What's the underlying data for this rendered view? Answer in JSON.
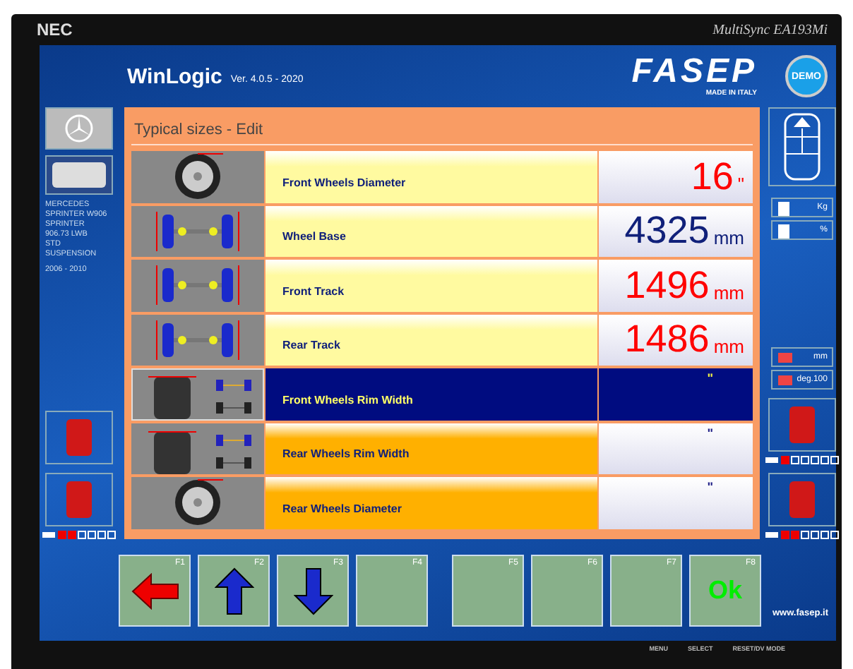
{
  "monitor": {
    "brand": "NEC",
    "model": "MultiSync EA193Mi",
    "buttons": [
      "MENU",
      "SELECT",
      "RESET/DV MODE"
    ]
  },
  "header": {
    "app": "WinLogic",
    "version": "Ver. 4.0.5 - 2020",
    "logo": "FASEP",
    "logo_tag": "MADE IN ITALY",
    "demo": "DEMO"
  },
  "vehicle": {
    "lines": [
      "MERCEDES",
      "SPRINTER W906",
      "SPRINTER",
      "906.73 LWB",
      "STD",
      "SUSPENSION"
    ],
    "years": "2006 - 2010"
  },
  "left_indicator": [
    {
      "on": true
    },
    {
      "on": true
    },
    {
      "on": false
    },
    {
      "on": false
    },
    {
      "on": false
    },
    {
      "on": false
    }
  ],
  "right_fields": [
    {
      "unit": "Kg"
    },
    {
      "unit": "%"
    }
  ],
  "right_fields_2": [
    {
      "unit": "mm"
    },
    {
      "unit": "deg.100"
    }
  ],
  "right_devices": [
    {
      "indicator": [
        {
          "on": true
        },
        {
          "on": false
        },
        {
          "on": false
        },
        {
          "on": false
        },
        {
          "on": false
        },
        {
          "on": false
        }
      ]
    },
    {
      "indicator": [
        {
          "on": true
        },
        {
          "on": true
        },
        {
          "on": false
        },
        {
          "on": false
        },
        {
          "on": false
        },
        {
          "on": false
        }
      ]
    }
  ],
  "panel": {
    "title": "Typical sizes - Edit",
    "rows": [
      {
        "label": "Front Wheels Diameter",
        "value": "16",
        "unit": "\"",
        "color": "#ff0000",
        "selected": false
      },
      {
        "label": "Wheel Base",
        "value": "4325",
        "unit": "mm",
        "color": "#10207a",
        "selected": false
      },
      {
        "label": "Front Track",
        "value": "1496",
        "unit": "mm",
        "color": "#ff0000",
        "selected": false
      },
      {
        "label": "Rear Track",
        "value": "1486",
        "unit": "mm",
        "color": "#ff0000",
        "selected": false
      },
      {
        "label": "Front Wheels Rim Width",
        "unit": "\"",
        "selected": true
      },
      {
        "label": "Rear Wheels Rim Width",
        "unit": "\"",
        "selected": false
      },
      {
        "label": "Rear Wheels Diameter",
        "unit": "\"",
        "selected": false
      }
    ]
  },
  "fkeys": [
    {
      "key": "F1",
      "kind": "left"
    },
    {
      "key": "F2",
      "kind": "up"
    },
    {
      "key": "F3",
      "kind": "down"
    },
    {
      "key": "F4",
      "kind": "blank"
    },
    {
      "key": "F5",
      "kind": "blank"
    },
    {
      "key": "F6",
      "kind": "blank"
    },
    {
      "key": "F7",
      "kind": "blank"
    },
    {
      "key": "F8",
      "kind": "text",
      "text": "Ok"
    }
  ],
  "website": "www.fasep.it"
}
